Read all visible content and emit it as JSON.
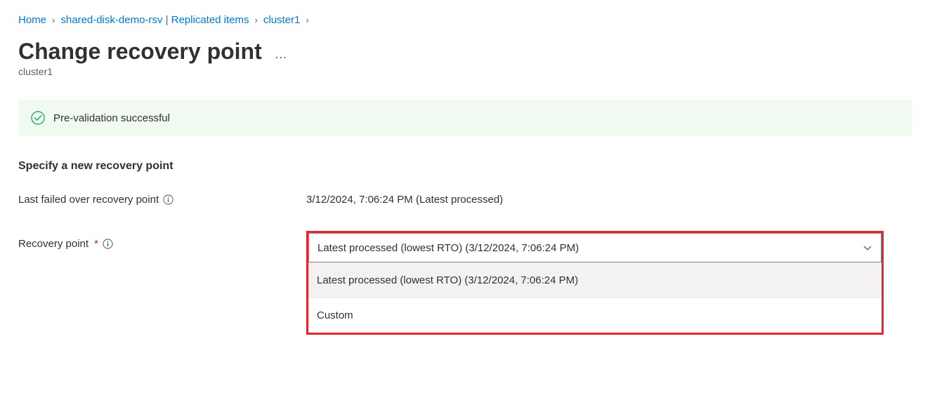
{
  "breadcrumb": {
    "home": "Home",
    "item1": "shared-disk-demo-rsv | Replicated items",
    "item2": "cluster1"
  },
  "page": {
    "title": "Change recovery point",
    "subtitle": "cluster1"
  },
  "notification": {
    "text": "Pre-validation successful"
  },
  "section": {
    "header": "Specify a new recovery point"
  },
  "form": {
    "lastFailedLabel": "Last failed over recovery point",
    "lastFailedValue": "3/12/2024, 7:06:24 PM (Latest processed)",
    "recoveryPointLabel": "Recovery point",
    "recoveryPointRequired": "*",
    "dropdown": {
      "selected": "Latest processed (lowest RTO) (3/12/2024, 7:06:24 PM)",
      "options": [
        "Latest processed (lowest RTO) (3/12/2024, 7:06:24 PM)",
        "Custom"
      ]
    }
  }
}
